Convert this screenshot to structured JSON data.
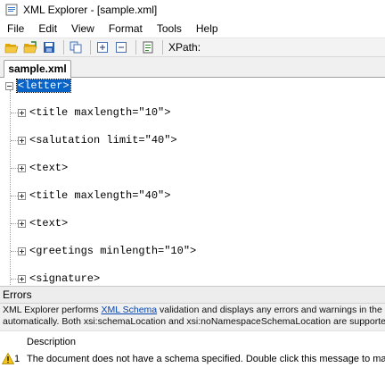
{
  "window": {
    "title": "XML Explorer - [sample.xml]"
  },
  "menu": [
    "File",
    "Edit",
    "View",
    "Format",
    "Tools",
    "Help"
  ],
  "toolbar": {
    "icons": [
      "open-folder-icon",
      "open-recent-icon",
      "save-icon",
      "copy-icon",
      "expand-all-icon",
      "collapse-all-icon",
      "schema-icon"
    ],
    "xpath_label": "XPath:"
  },
  "tab": {
    "label": "sample.xml"
  },
  "tree": {
    "root": "<letter>",
    "children": [
      "<title maxlength=\"10\">",
      "<salutation limit=\"40\">",
      "<text>",
      "<title maxlength=\"40\">",
      "<text>",
      "<greetings minlength=\"10\">",
      "<signature>"
    ]
  },
  "errors": {
    "header": "Errors",
    "desc_before_link": "XML Explorer performs ",
    "desc_link": "XML Schema",
    "desc_after_link": " validation and displays any errors and warnings in the list below",
    "desc_line2": "automatically. Both xsi:schemaLocation and xsi:noNamespaceSchemaLocation are supported. You ca",
    "column_description": "Description",
    "rows": [
      {
        "num": "1",
        "text": "The document does not have a schema specified.  Double click this message to manually assign a"
      }
    ]
  }
}
